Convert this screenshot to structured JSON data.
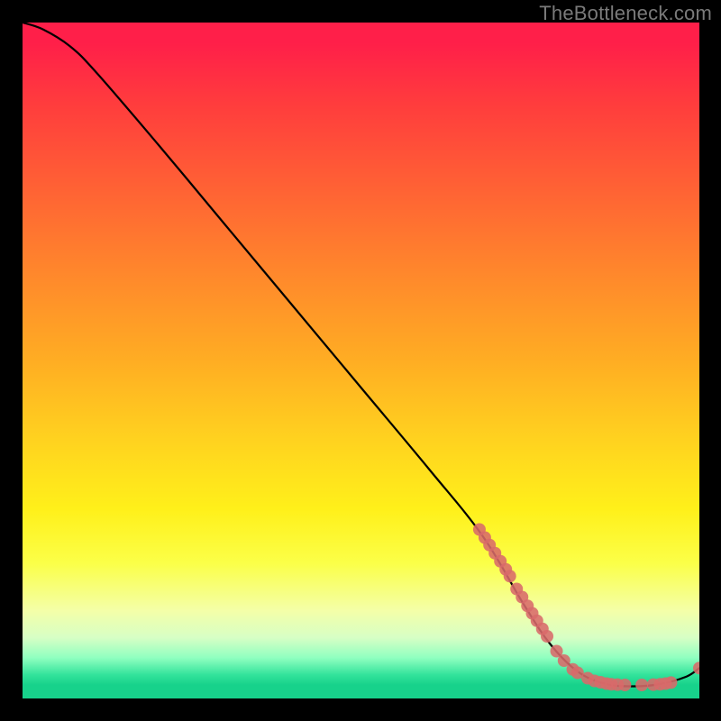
{
  "watermark": "TheBottleneck.com",
  "chart_data": {
    "type": "line",
    "title": "",
    "xlabel": "",
    "ylabel": "",
    "xlim": [
      0,
      100
    ],
    "ylim": [
      0,
      100
    ],
    "grid": false,
    "legend": false,
    "background_gradient": {
      "orientation": "vertical",
      "stops": [
        {
          "pos": 0,
          "color": "#ff1f49"
        },
        {
          "pos": 50,
          "color": "#ffad23"
        },
        {
          "pos": 80,
          "color": "#fbff48"
        },
        {
          "pos": 96,
          "color": "#33e39b"
        },
        {
          "pos": 100,
          "color": "#17d28b"
        }
      ]
    },
    "series": [
      {
        "name": "curve",
        "style": "line",
        "color": "#000000",
        "points": [
          {
            "x": 0,
            "y": 100
          },
          {
            "x": 3,
            "y": 99
          },
          {
            "x": 7,
            "y": 96.5
          },
          {
            "x": 11,
            "y": 92.5
          },
          {
            "x": 20,
            "y": 82
          },
          {
            "x": 30,
            "y": 70
          },
          {
            "x": 40,
            "y": 58
          },
          {
            "x": 50,
            "y": 46
          },
          {
            "x": 60,
            "y": 34
          },
          {
            "x": 68,
            "y": 24
          },
          {
            "x": 74,
            "y": 14
          },
          {
            "x": 78,
            "y": 8
          },
          {
            "x": 82,
            "y": 4
          },
          {
            "x": 86,
            "y": 2.2
          },
          {
            "x": 90,
            "y": 1.8
          },
          {
            "x": 94,
            "y": 2.1
          },
          {
            "x": 98,
            "y": 3.2
          },
          {
            "x": 100,
            "y": 4.5
          }
        ]
      },
      {
        "name": "markers",
        "style": "scatter",
        "color": "#d86a6a",
        "points": [
          {
            "x": 67.5,
            "y": 25
          },
          {
            "x": 68.3,
            "y": 23.8
          },
          {
            "x": 69,
            "y": 22.7
          },
          {
            "x": 69.8,
            "y": 21.5
          },
          {
            "x": 70.6,
            "y": 20.3
          },
          {
            "x": 71.4,
            "y": 19.1
          },
          {
            "x": 72.0,
            "y": 18.1
          },
          {
            "x": 73.0,
            "y": 16.2
          },
          {
            "x": 73.8,
            "y": 15.0
          },
          {
            "x": 74.6,
            "y": 13.7
          },
          {
            "x": 75.3,
            "y": 12.6
          },
          {
            "x": 76.0,
            "y": 11.5
          },
          {
            "x": 76.8,
            "y": 10.3
          },
          {
            "x": 77.5,
            "y": 9.2
          },
          {
            "x": 78.9,
            "y": 7.0
          },
          {
            "x": 80.0,
            "y": 5.6
          },
          {
            "x": 81.3,
            "y": 4.3
          },
          {
            "x": 82.0,
            "y": 3.8
          },
          {
            "x": 83.5,
            "y": 3.0
          },
          {
            "x": 84.5,
            "y": 2.6
          },
          {
            "x": 85.4,
            "y": 2.4
          },
          {
            "x": 86.3,
            "y": 2.2
          },
          {
            "x": 87.0,
            "y": 2.1
          },
          {
            "x": 87.9,
            "y": 2.05
          },
          {
            "x": 89.0,
            "y": 2.0
          },
          {
            "x": 91.5,
            "y": 2.0
          },
          {
            "x": 93.2,
            "y": 2.05
          },
          {
            "x": 94.2,
            "y": 2.1
          },
          {
            "x": 95.0,
            "y": 2.2
          },
          {
            "x": 95.8,
            "y": 2.35
          },
          {
            "x": 100,
            "y": 4.5
          }
        ]
      }
    ]
  }
}
